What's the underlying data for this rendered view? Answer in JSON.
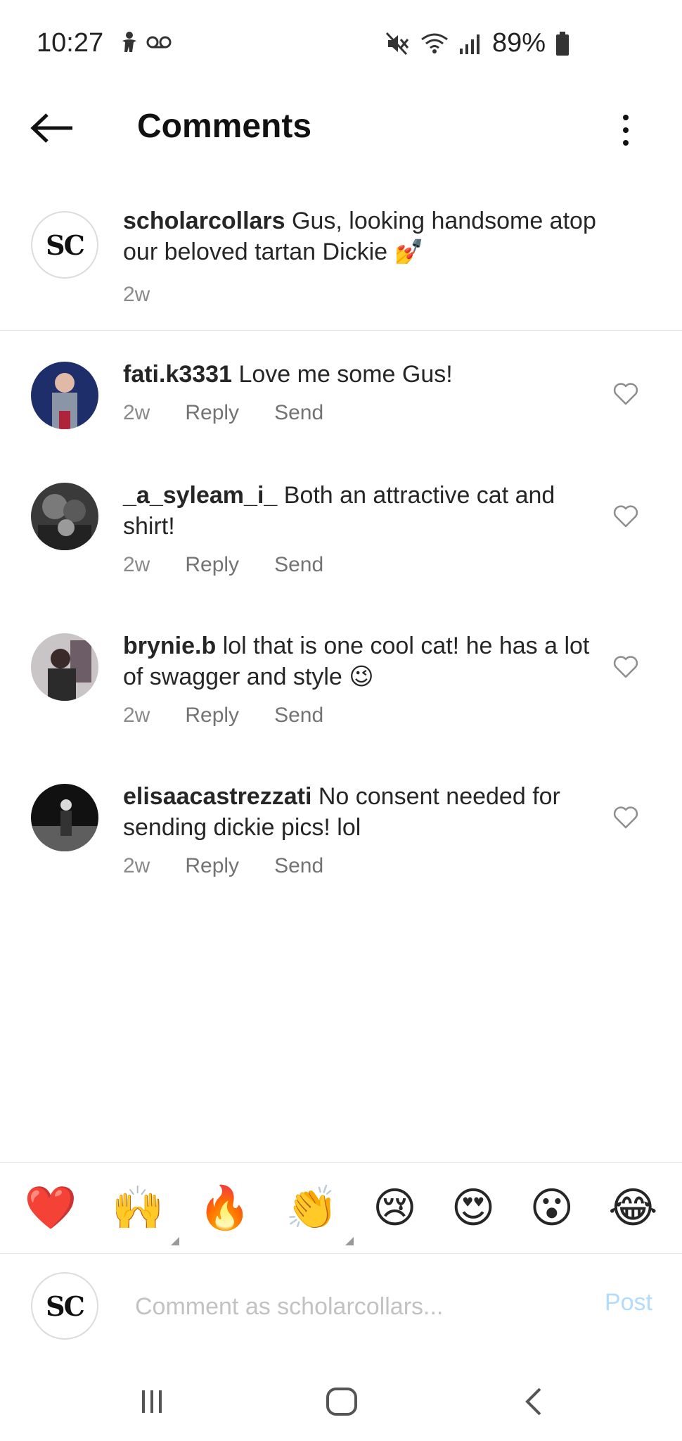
{
  "status_bar": {
    "time": "10:27",
    "battery_percent": "89%"
  },
  "header": {
    "title": "Comments"
  },
  "caption": {
    "avatar_text": "SC",
    "username": "scholarcollars",
    "text": "Gus, looking handsome atop our beloved tartan Dickie 💅",
    "age": "2w"
  },
  "comments": [
    {
      "username": "fati.k3331",
      "text": "Love me some Gus!",
      "age": "2w",
      "reply_label": "Reply",
      "send_label": "Send"
    },
    {
      "username": "_a_syleam_i_",
      "text": "Both an attractive cat and shirt!",
      "age": "2w",
      "reply_label": "Reply",
      "send_label": "Send"
    },
    {
      "username": "brynie.b",
      "text": "lol that is one cool cat! he has a lot of swagger and style 😉",
      "age": "2w",
      "reply_label": "Reply",
      "send_label": "Send"
    },
    {
      "username": "elisaacastrezzati",
      "text": "No consent needed for sending dickie pics! lol",
      "age": "2w",
      "reply_label": "Reply",
      "send_label": "Send"
    }
  ],
  "emoji_bar": [
    "❤️",
    "🙌",
    "🔥",
    "👏",
    "😢",
    "😍",
    "😮",
    "😂"
  ],
  "composer": {
    "avatar_text": "SC",
    "placeholder": "Comment as scholarcollars...",
    "post_label": "Post"
  },
  "colors": {
    "post_disabled": "#b3dbff",
    "meta_gray": "#737373",
    "divider": "#e2e2e2"
  },
  "icons": {
    "back": "arrow-left-icon",
    "more": "more-vertical-icon",
    "like": "heart-outline-icon"
  }
}
